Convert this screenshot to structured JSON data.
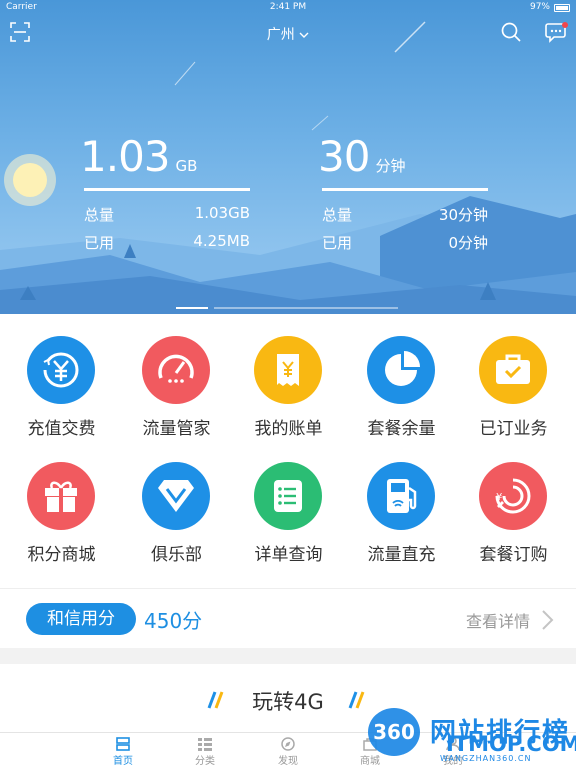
{
  "status_bar": {
    "carrier": "Carrier",
    "time": "2:41 PM",
    "battery": "97%"
  },
  "header": {
    "city": "广州"
  },
  "usage": {
    "data": {
      "value": "1.03",
      "unit": "GB",
      "total_label": "总量",
      "total": "1.03GB",
      "used_label": "已用",
      "used": "4.25MB"
    },
    "voice": {
      "value": "30",
      "unit": "分钟",
      "total_label": "总量",
      "total": "30分钟",
      "used_label": "已用",
      "used": "0分钟"
    }
  },
  "grid": [
    {
      "label": "充值交费",
      "color": "#1e90e6",
      "icon": "yen-recharge-icon"
    },
    {
      "label": "流量管家",
      "color": "#f15a5f",
      "icon": "speedometer-icon"
    },
    {
      "label": "我的账单",
      "color": "#f9b812",
      "icon": "bill-icon"
    },
    {
      "label": "套餐余量",
      "color": "#1e90e6",
      "icon": "pie-chart-icon"
    },
    {
      "label": "已订业务",
      "color": "#f9b812",
      "icon": "briefcase-icon"
    },
    {
      "label": "积分商城",
      "color": "#f15a5f",
      "icon": "gift-icon"
    },
    {
      "label": "俱乐部",
      "color": "#1e90e6",
      "icon": "vip-diamond-icon"
    },
    {
      "label": "详单查询",
      "color": "#2bbd74",
      "icon": "list-icon"
    },
    {
      "label": "流量直充",
      "color": "#1e90e6",
      "icon": "fuel-pump-icon"
    },
    {
      "label": "套餐订购",
      "color": "#f15a5f",
      "icon": "yen-order-icon"
    }
  ],
  "credit": {
    "label": "和信用分",
    "score": "450分",
    "more": "查看详情"
  },
  "promo": {
    "title": "玩转4G"
  },
  "tabs": [
    {
      "label": "首页",
      "active": true
    },
    {
      "label": "分类",
      "active": false
    },
    {
      "label": "发现",
      "active": false
    },
    {
      "label": "商城",
      "active": false
    },
    {
      "label": "我的",
      "active": false
    }
  ],
  "watermark": {
    "badge": "360",
    "cn": "网站排行榜",
    "en": "ITMOP.COM",
    "tiny": "WANGZHAN360.CN"
  }
}
